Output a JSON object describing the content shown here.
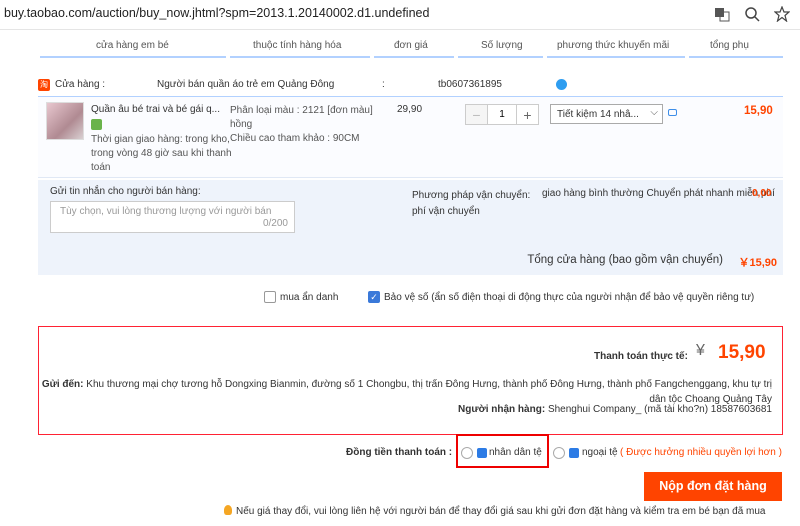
{
  "browser": {
    "url": "buy.taobao.com/auction/buy_now.jhtml?spm=2013.1.20140002.d1.undefined",
    "icons": [
      "translate-icon",
      "zoom-icon",
      "star-icon"
    ]
  },
  "columns": {
    "store": "cửa hàng em bé",
    "attributes": "thuộc tính hàng hóa",
    "unit_price": "đơn giá",
    "quantity": "Số lượng",
    "promotion": "phương thức khuyến mãi",
    "subtotal": "tổng phụ"
  },
  "shop": {
    "badge": "淘",
    "label": "Cửa hàng :",
    "seller": "Người bán quần áo trẻ em Quảng Đông",
    "colon": ":",
    "seller_id": "tb0607361895"
  },
  "item": {
    "title": "Quần âu bé trai và bé gái q...",
    "delivery": "Thời gian giao hàng: trong kho, trong vòng 48 giờ sau khi thanh toán",
    "sku_color": "Phân loại màu : 2121 [đơn màu] hồng",
    "sku_size": "Chiều cao tham khảo : 90CM",
    "unit_price": "29,90",
    "quantity": "1",
    "minus": "−",
    "plus": "+",
    "promotion": "Tiết kiệm 14 nhâ...",
    "subtotal": "15,90"
  },
  "message": {
    "label": "Gửi tin nhắn cho người bán hàng:",
    "placeholder": "Tùy chọn, vui lòng thương lượng với người bán",
    "counter": "0/200"
  },
  "shipping": {
    "label": "Phương pháp vận chuyển: phí vận chuyển",
    "method": "giao hàng bình thường Chuyển phát nhanh miễn phí",
    "fee": "0,00"
  },
  "store_total": {
    "label": "Tổng cửa hàng (bao gồm vận chuyển)",
    "value": "￥15,90"
  },
  "options": {
    "anonymous": "mua ẩn danh",
    "privacy": "Bảo vệ số (ẩn số điện thoại di động thực của người nhận để bảo vệ quyền riêng tư)"
  },
  "payment": {
    "label": "Thanh toán thực tế:",
    "currency_symbol": "¥",
    "amount": "15,90",
    "ship_to_label": "Gửi đến:",
    "address": "Khu thương mại chợ tương hỗ Dongxing Bianmin, đường số 1 Chongbu, thị trấn Đông Hưng, thành phố Đông Hưng, thành phố Fangchenggang, khu tự trị dân tộc Choang Quảng Tây",
    "recipient_label": "Người nhận hàng:",
    "recipient": "Shenghui Company_ (mã tài kho?n) 18587603681"
  },
  "currency": {
    "label": "Đồng tiền thanh toán :",
    "rmb": "nhân dân tệ",
    "foreign": "ngoại tệ",
    "note": "( Được hưởng nhiều quyền lợi hơn )"
  },
  "submit_label": "Nộp đơn đặt hàng",
  "footer_note": "Nếu giá thay đổi, vui lòng liên hệ với người bán để thay đổi giá sau khi gửi đơn đặt hàng và kiểm tra em bé bạn đã mua",
  "colors": {
    "accent": "#ff4400",
    "blue": "#3a79d9",
    "highlight": "#ee0000"
  }
}
